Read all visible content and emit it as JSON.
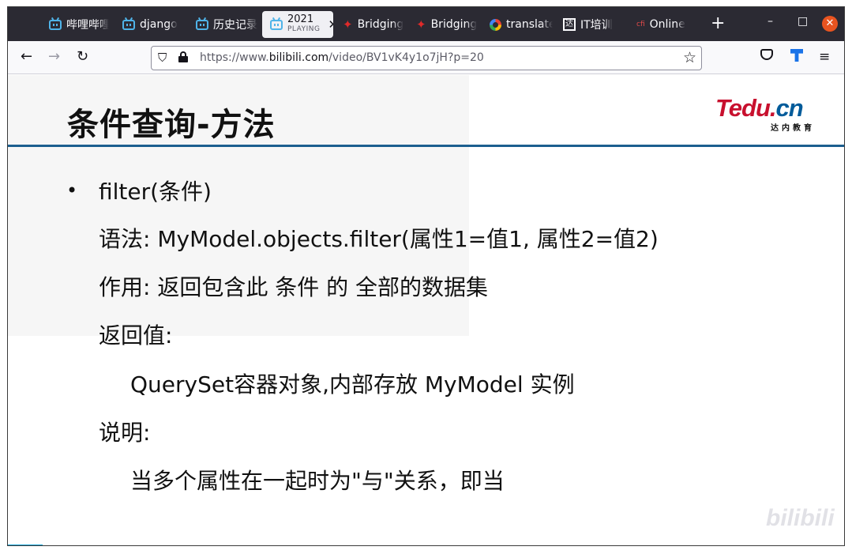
{
  "tabs": [
    {
      "label": "哔哩哔哩",
      "icon": "bilibili-icon"
    },
    {
      "label": "django",
      "icon": "bilibili-icon"
    },
    {
      "label": "历史记录",
      "icon": "bilibili-icon"
    },
    {
      "label": "2021",
      "sub": "PLAYING",
      "icon": "bilibili-icon",
      "active": true
    },
    {
      "label": "Bridging",
      "icon": "maple-leaf-icon"
    },
    {
      "label": "Bridging",
      "icon": "maple-leaf-icon"
    },
    {
      "label": "translate",
      "icon": "google-icon"
    },
    {
      "label": "IT培训",
      "icon": "tarena-icon"
    },
    {
      "label": "Online",
      "icon": "cfi-icon"
    }
  ],
  "window": {
    "new_tab": "+",
    "minimize": "–",
    "maximize": "□",
    "close": "✕"
  },
  "navbar": {
    "back": "←",
    "forward": "→",
    "reload": "↻",
    "url_prefix": "https://www.",
    "url_domain": "bilibili.com",
    "url_path": "/video/BV1vK4y1o7jH?p=20",
    "star": "☆",
    "menu": "≡"
  },
  "slide": {
    "title": "条件查询-方法",
    "logo_main": "Tedu.",
    "logo_tld": "cn",
    "logo_sub": "达内教育",
    "bullet": "•",
    "lines": [
      "filter(条件)",
      "语法: MyModel.objects.filter(属性1=值1, 属性2=值2)",
      "作用: 返回包含此 条件 的 全部的数据集",
      "返回值:",
      "QuerySet容器对象,内部存放 MyModel 实例",
      "说明:",
      "当多个属性在一起时为\"与\"关系，即当"
    ],
    "watermark": "bilibili"
  },
  "colors": {
    "tabbar": "#2b2a33",
    "rule": "#1c5f8f",
    "logo_red": "#c8102e",
    "logo_blue": "#005b9a",
    "close": "#e95420"
  }
}
